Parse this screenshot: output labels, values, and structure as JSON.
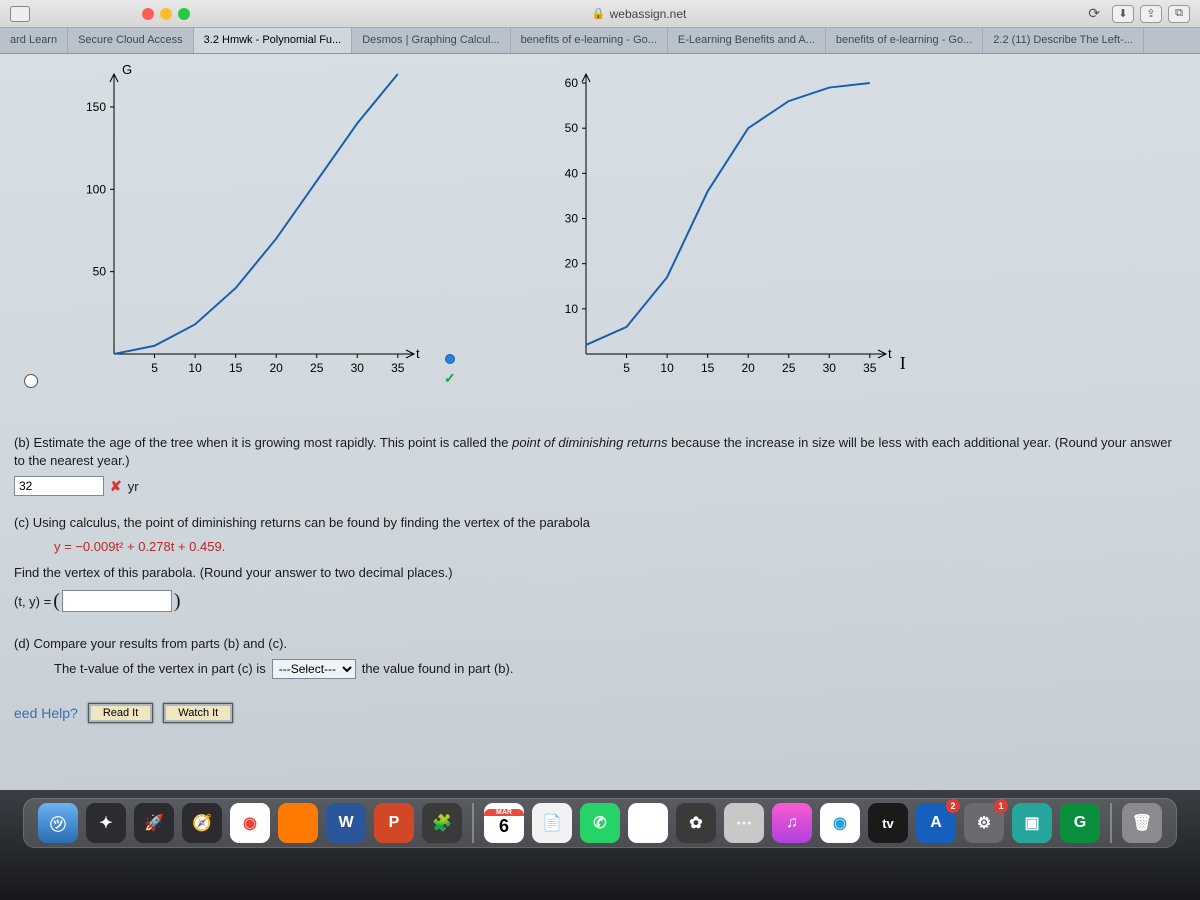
{
  "browser": {
    "url_host": "webassign.net",
    "tabs": [
      "ard Learn",
      "Secure Cloud Access",
      "3.2 Hmwk - Polynomial Fu...",
      "Desmos | Graphing Calcul...",
      "benefits of e-learning - Go...",
      "E-Learning Benefits and A...",
      "benefits of e-learning - Go...",
      "2.2 (11) Describe The Left-..."
    ],
    "active_tab_index": 2
  },
  "chart_data": [
    {
      "type": "line",
      "title": "",
      "xlabel": "t",
      "ylabel": "G",
      "x": [
        0,
        5,
        10,
        15,
        20,
        25,
        30,
        35
      ],
      "y": [
        0,
        5,
        18,
        40,
        70,
        105,
        140,
        170
      ],
      "xlim": [
        0,
        37
      ],
      "ylim": [
        0,
        170
      ],
      "xticks": [
        5,
        10,
        15,
        20,
        25,
        30,
        35
      ],
      "yticks": [
        50,
        100,
        150
      ]
    },
    {
      "type": "line",
      "title": "",
      "xlabel": "t",
      "ylabel": "",
      "x": [
        0,
        5,
        10,
        15,
        20,
        25,
        30,
        35
      ],
      "y": [
        2,
        6,
        17,
        36,
        50,
        56,
        59,
        60
      ],
      "xlim": [
        0,
        37
      ],
      "ylim": [
        0,
        62
      ],
      "xticks": [
        5,
        10,
        15,
        20,
        25,
        30,
        35
      ],
      "yticks": [
        10,
        20,
        30,
        40,
        50,
        60
      ]
    }
  ],
  "question": {
    "b_text_1": "(b) Estimate the age of the tree when it is growing most rapidly. This point is called the ",
    "b_text_italic": "point of diminishing returns",
    "b_text_2": " because the increase in size will be less with each additional year. (Round your answer to the nearest year.)",
    "b_answer": "32",
    "b_unit": "yr",
    "c_text": "(c) Using calculus, the point of diminishing returns can be found by finding the vertex of the parabola",
    "c_formula": "y = −0.009t² + 0.278t + 0.459.",
    "c_instr": "Find the vertex of this parabola. (Round your answer to two decimal places.)",
    "c_pair_label": "(t, y) = ",
    "d_text": "(d) Compare your results from parts (b) and (c).",
    "d_sub1": "The t-value of the vertex in part (c) is ",
    "d_select_placeholder": "---Select---",
    "d_sub2": " the value found in part (b).",
    "help_label": "eed Help?",
    "read_btn": "Read It",
    "watch_btn": "Watch It"
  },
  "dock": {
    "calendar_month": "MAR",
    "calendar_day": "6",
    "tv_label": "tv",
    "badge1": "2",
    "badge2": "1"
  }
}
